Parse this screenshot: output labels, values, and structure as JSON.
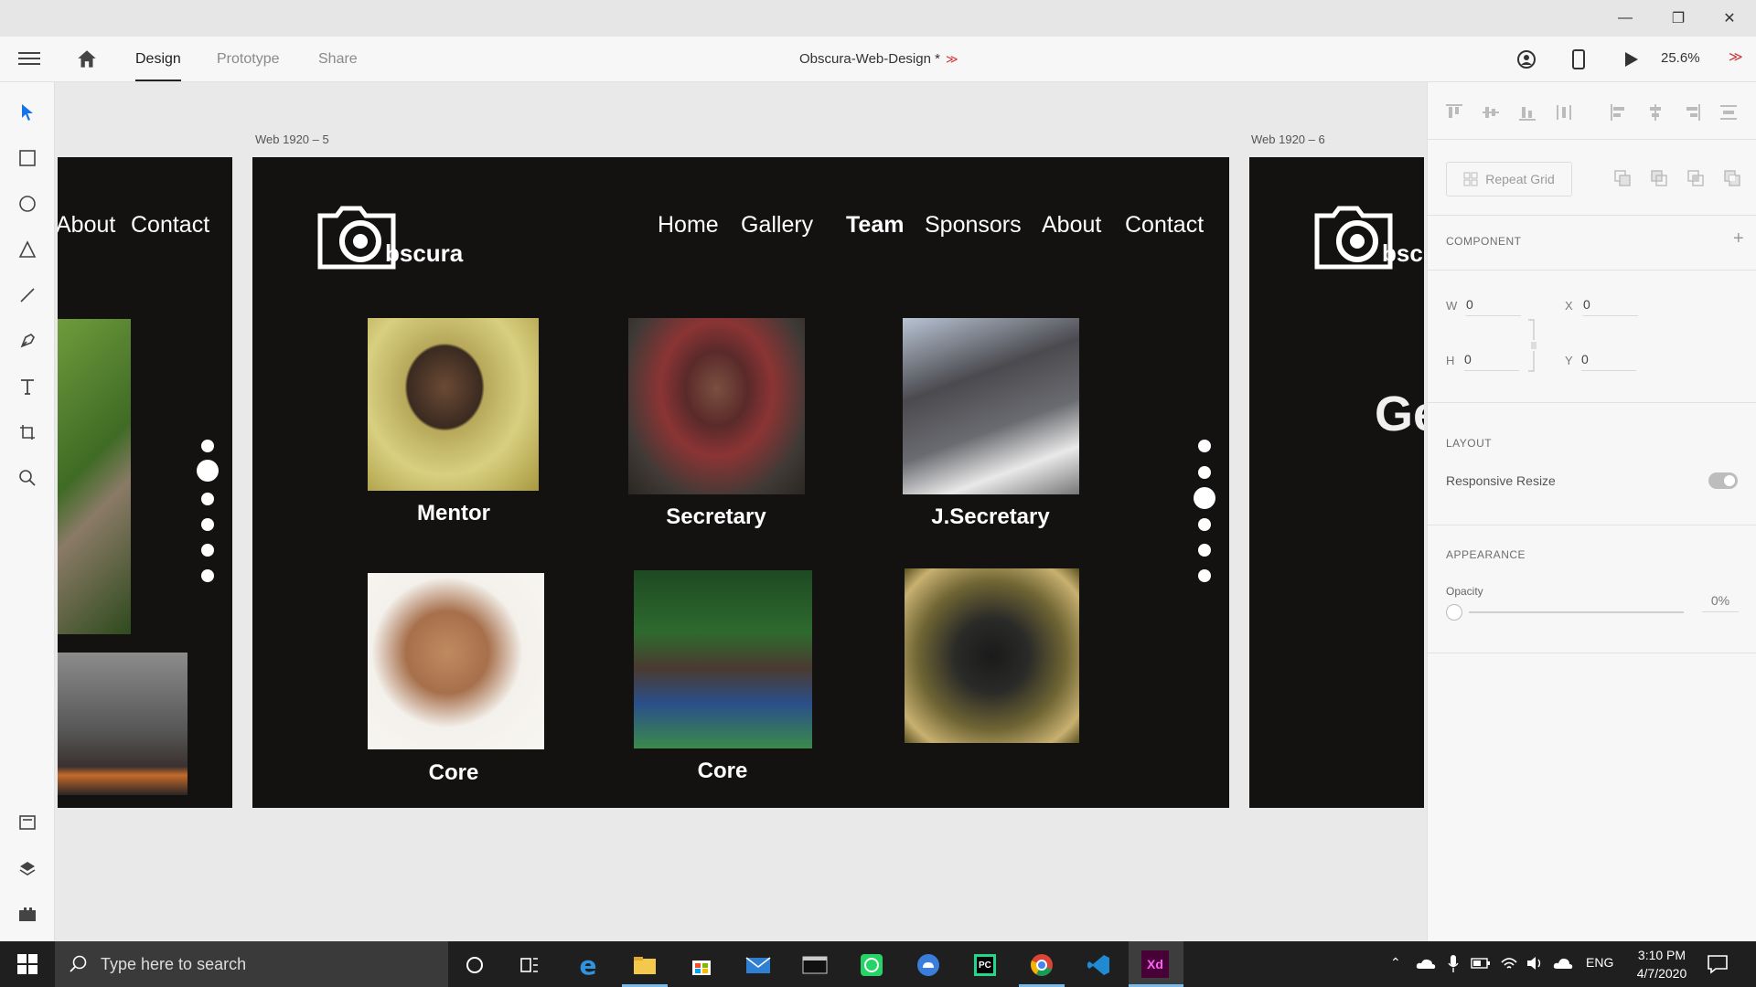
{
  "app": {
    "tabs": [
      {
        "label": "Design",
        "active": true
      },
      {
        "label": "Prototype",
        "active": false
      },
      {
        "label": "Share",
        "active": false
      }
    ],
    "document_title": "Obscura-Web-Design *",
    "zoom": "25.6%"
  },
  "canvas": {
    "artboard_left_label": "Web 1920 – 5",
    "artboard_right_label": "Web 1920 – 6",
    "left_partial": {
      "nav": [
        "About",
        "Contact"
      ]
    },
    "main": {
      "logo_text": "bscura",
      "nav": [
        {
          "label": "Home",
          "bold": false
        },
        {
          "label": "Gallery",
          "bold": false
        },
        {
          "label": "Team",
          "bold": true
        },
        {
          "label": "Sponsors",
          "bold": false
        },
        {
          "label": "About",
          "bold": false
        },
        {
          "label": "Contact",
          "bold": false
        }
      ],
      "members": [
        {
          "caption": "Mentor"
        },
        {
          "caption": "Secretary"
        },
        {
          "caption": "J.Secretary"
        },
        {
          "caption": "Core"
        },
        {
          "caption": "Core"
        },
        {
          "caption": ""
        }
      ]
    },
    "right_partial": {
      "logo_text": "bscu",
      "heading_fragment": "Ge"
    }
  },
  "panel": {
    "repeat_grid_label": "Repeat Grid",
    "component_label": "COMPONENT",
    "fields": {
      "w_label": "W",
      "w": "0",
      "x_label": "X",
      "x": "0",
      "h_label": "H",
      "h": "0",
      "y_label": "Y",
      "y": "0"
    },
    "layout_label": "LAYOUT",
    "responsive_resize_label": "Responsive Resize",
    "appearance_label": "APPEARANCE",
    "opacity_label": "Opacity",
    "opacity_value": "0%"
  },
  "taskbar": {
    "search_placeholder": "Type here to search",
    "language": "ENG",
    "time": "3:10 PM",
    "date": "4/7/2020"
  },
  "colors": {
    "accent": "#1473e6",
    "artboard": "#141111",
    "xd": "#470137",
    "xd_pink": "#ff61f6"
  }
}
